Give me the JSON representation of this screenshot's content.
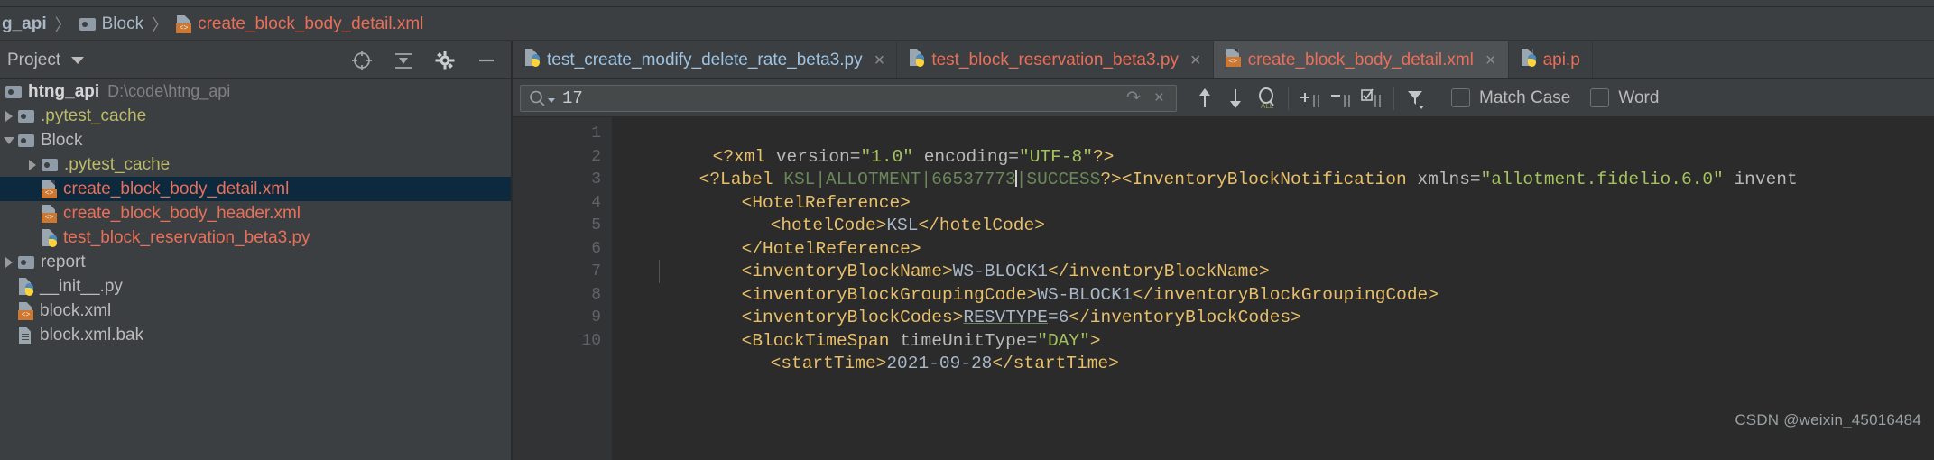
{
  "breadcrumb": {
    "items": [
      {
        "label": "g_api",
        "icon": "none",
        "type": "project"
      },
      {
        "label": "Block",
        "icon": "folder-icon",
        "type": "folder"
      },
      {
        "label": "create_block_body_detail.xml",
        "icon": "xml-file-icon",
        "type": "file"
      }
    ],
    "separator": "〉"
  },
  "panel": {
    "title": "Project",
    "caret": "chevron-down-icon",
    "tools": [
      "locate-icon",
      "collapse-all-icon",
      "settings-gear-icon",
      "hide-panel-icon"
    ]
  },
  "tree": {
    "nodes": [
      {
        "label": "htng_api",
        "path": "D:\\code\\htng_api",
        "icon": "folder-icon",
        "indent": 0,
        "arrow": "none",
        "style": "bold",
        "selected": false
      },
      {
        "label": ".pytest_cache",
        "path": "",
        "icon": "folder-icon",
        "indent": 1,
        "arrow": "closed",
        "style": "yellowish",
        "selected": false
      },
      {
        "label": "Block",
        "path": "",
        "icon": "folder-module-icon",
        "indent": 1,
        "arrow": "open",
        "style": "grey",
        "selected": false
      },
      {
        "label": ".pytest_cache",
        "path": "",
        "icon": "folder-icon",
        "indent": 2,
        "arrow": "closed",
        "style": "yellowish",
        "selected": false
      },
      {
        "label": "create_block_body_detail.xml",
        "path": "",
        "icon": "xml-file-icon",
        "indent": 2,
        "arrow": "none",
        "style": "salmon",
        "selected": true
      },
      {
        "label": "create_block_body_header.xml",
        "path": "",
        "icon": "xml-file-icon",
        "indent": 2,
        "arrow": "none",
        "style": "salmon",
        "selected": false
      },
      {
        "label": "test_block_reservation_beta3.py",
        "path": "",
        "icon": "python-file-icon",
        "indent": 2,
        "arrow": "none",
        "style": "salmon",
        "selected": false
      },
      {
        "label": "report",
        "path": "",
        "icon": "folder-module-icon",
        "indent": 1,
        "arrow": "closed",
        "style": "grey",
        "selected": false
      },
      {
        "label": "__init__.py",
        "path": "",
        "icon": "python-file-icon",
        "indent": 1,
        "arrow": "none",
        "style": "grey",
        "selected": false
      },
      {
        "label": "block.xml",
        "path": "",
        "icon": "xml-file-icon",
        "indent": 1,
        "arrow": "none",
        "style": "grey",
        "selected": false
      },
      {
        "label": "block.xml.bak",
        "path": "",
        "icon": "plain-file-icon",
        "indent": 1,
        "arrow": "none",
        "style": "grey",
        "selected": false
      }
    ]
  },
  "tabs": [
    {
      "label": "test_create_modify_delete_rate_beta3.py",
      "icon": "python-file-icon",
      "kind": "py",
      "active": false,
      "close": "×"
    },
    {
      "label": "test_block_reservation_beta3.py",
      "icon": "python-file-icon",
      "kind": "py-salmon",
      "active": false,
      "close": "×"
    },
    {
      "label": "create_block_body_detail.xml",
      "icon": "xml-file-icon",
      "kind": "xml",
      "active": true,
      "close": "×"
    },
    {
      "label": "api.p",
      "icon": "python-file-icon",
      "kind": "py-salmon",
      "active": false,
      "close": ""
    }
  ],
  "search": {
    "icon": "search-magnifier-icon",
    "dropdown_caret": "chevron-down-icon",
    "value": "17",
    "placeholder": "",
    "history_button": "search-history-icon",
    "clear_button": "×",
    "tools": [
      {
        "name": "find-previous-icon",
        "glyph": "↑"
      },
      {
        "name": "find-next-icon",
        "glyph": "↓"
      },
      {
        "name": "find-all-icon",
        "glyph": "ALL"
      },
      {
        "name": "add-selection-icon",
        "glyph": "+"
      },
      {
        "name": "remove-selection-icon",
        "glyph": "−"
      },
      {
        "name": "select-all-occurrences-icon",
        "glyph": "☑"
      },
      {
        "name": "filter-icon",
        "glyph": "▼"
      }
    ],
    "checkboxes": [
      {
        "label": "Match Case",
        "mnemonic": "C",
        "checked": false
      },
      {
        "label": "Word",
        "mnemonic": "W",
        "checked": false
      }
    ]
  },
  "code": {
    "language": "xml",
    "lines": [
      {
        "num": "1",
        "fold": "none",
        "indent": 0
      },
      {
        "num": "2",
        "fold": "start",
        "indent": 0
      },
      {
        "num": "3",
        "fold": "start",
        "indent": 1
      },
      {
        "num": "4",
        "fold": "none",
        "indent": 2
      },
      {
        "num": "5",
        "fold": "end",
        "indent": 1
      },
      {
        "num": "6",
        "fold": "none",
        "indent": 1
      },
      {
        "num": "7",
        "fold": "none",
        "indent": 1
      },
      {
        "num": "8",
        "fold": "none",
        "indent": 1
      },
      {
        "num": "9",
        "fold": "start",
        "indent": 1
      },
      {
        "num": "10",
        "fold": "none",
        "indent": 2
      }
    ],
    "line1": {
      "prolog_open": "<?xml ",
      "attr1": "version=",
      "val1": "\"1.0\"",
      "space": " ",
      "attr2": "encoding=",
      "val2": "\"UTF-8\"",
      "prolog_close": "?>"
    },
    "line2": {
      "open": "<?Label ",
      "data": "KSL|ALLOTMENT|66537773",
      "data_after": "|SUCCESS",
      "close": "?>",
      "tag_open": "<InventoryBlockNotification ",
      "attr_xmlns": "xmlns=",
      "attr_xmlns_val": "\"allotment.fidelio.6.0\"",
      "attr_next": " invent"
    },
    "line3": "<HotelReference>",
    "line4_open": "<hotelCode>",
    "line4_val": "KSL",
    "line4_close": "</hotelCode>",
    "line5": "</HotelReference>",
    "line6_open": "<inventoryBlockName>",
    "line6_val": "WS-BLOCK1",
    "line6_close": "</inventoryBlockName>",
    "line7_open": "<inventoryBlockGroupingCode>",
    "line7_val": "WS-BLOCK1",
    "line7_close": "</inventoryBlockGroupingCode>",
    "line8_open": "<inventoryBlockCodes>",
    "line8_val": "RESVTYPE",
    "line8_val2": "=6",
    "line8_close": "</inventoryBlockCodes>",
    "line9_open": "<BlockTimeSpan ",
    "line9_attr": "timeUnitType=",
    "line9_val": "\"DAY\"",
    "line9_close": ">",
    "line10_open": "<startTime>",
    "line10_val": "2021-09-28",
    "line10_close": "</startTime>"
  },
  "watermark": "CSDN @weixin_45016484",
  "colors": {
    "panel_bg": "#3c3f41",
    "editor_bg": "#2b2b2b",
    "gutter_bg": "#313335",
    "selection_bg": "#0d293e",
    "tab_active_bg": "#4e5254",
    "salmon": "#e8705a",
    "xml_tag": "#e8bf6a",
    "xml_string": "#a5c261",
    "xml_value": "#6a8759",
    "text": "#a9b7c6",
    "muted": "#808080"
  }
}
